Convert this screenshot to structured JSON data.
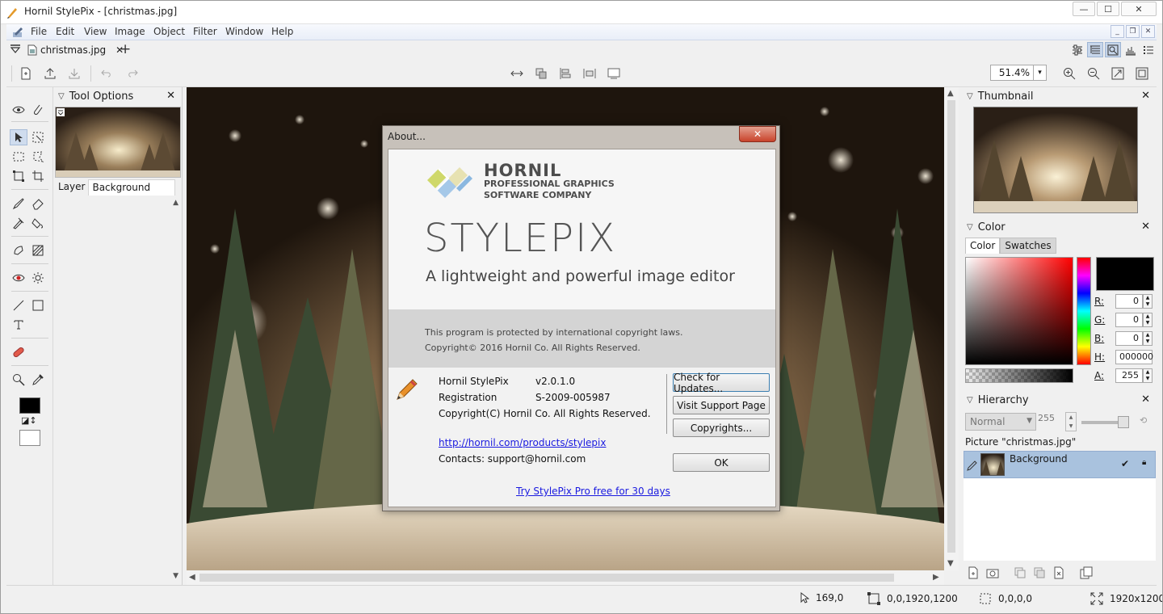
{
  "window": {
    "title": "Hornil StylePix - [christmas.jpg]",
    "buttons": {
      "minimize": "—",
      "maximize": "☐",
      "close": "✕"
    }
  },
  "menu": {
    "items": [
      "File",
      "Edit",
      "View",
      "Image",
      "Object",
      "Filter",
      "Window",
      "Help"
    ]
  },
  "tabs": {
    "document": "christmas.jpg",
    "close": "✕",
    "add": "+"
  },
  "toolbar": {
    "zoom": "51.4%",
    "zoom_arrow": "▾"
  },
  "tool_options": {
    "title": "Tool Options",
    "close": "✕",
    "tabs": [
      "Layer",
      "Background"
    ]
  },
  "dialog": {
    "title": "About...",
    "close": "✕",
    "brand": "HORNIL",
    "brand_sub1": "PROFESSIONAL GRAPHICS",
    "brand_sub2": "SOFTWARE COMPANY",
    "product": "STYLEPIX",
    "tagline": "A lightweight and powerful image editor",
    "legal1": "This program is protected by international copyright laws.",
    "legal2": "Copyright© 2016 Hornil Co. All Rights Reserved.",
    "app_name": "Hornil StylePix",
    "version": "v2.0.1.0",
    "registration_label": "Registration",
    "registration_value": "S-2009-005987",
    "copyright": "Copyright(C) Hornil Co. All Rights Reserved.",
    "link": "http://hornil.com/products/stylepix",
    "contacts": "Contacts: support@hornil.com",
    "promo": "Try StylePix Pro free for 30 days",
    "buttons": {
      "check_updates": "Check for Updates...",
      "support": "Visit Support Page",
      "copyrights": "Copyrights...",
      "ok": "OK"
    }
  },
  "thumbnail_panel": {
    "title": "Thumbnail",
    "close": "✕"
  },
  "color_panel": {
    "title": "Color",
    "close": "✕",
    "tabs": [
      "Color",
      "Swatches"
    ],
    "r_label": "R:",
    "r": "0",
    "g_label": "G:",
    "g": "0",
    "b_label": "B:",
    "b": "0",
    "h_label": "H:",
    "hex": "000000",
    "a_label": "A:",
    "a": "255",
    "current_color": "#000000"
  },
  "hierarchy_panel": {
    "title": "Hierarchy",
    "close": "✕",
    "blend_mode": "Normal",
    "opacity": "255",
    "picture_line": "Picture \"christmas.jpg\"",
    "layer_name": "Background"
  },
  "status": {
    "cursor": "169,0",
    "image_rect": "0,0,1920,1200",
    "selection": "0,0,0,0",
    "size": "1920x1200"
  },
  "colors": {
    "accent": "#a9c2de",
    "link": "#1a1ae0",
    "dialog_close": "#c8432b"
  }
}
